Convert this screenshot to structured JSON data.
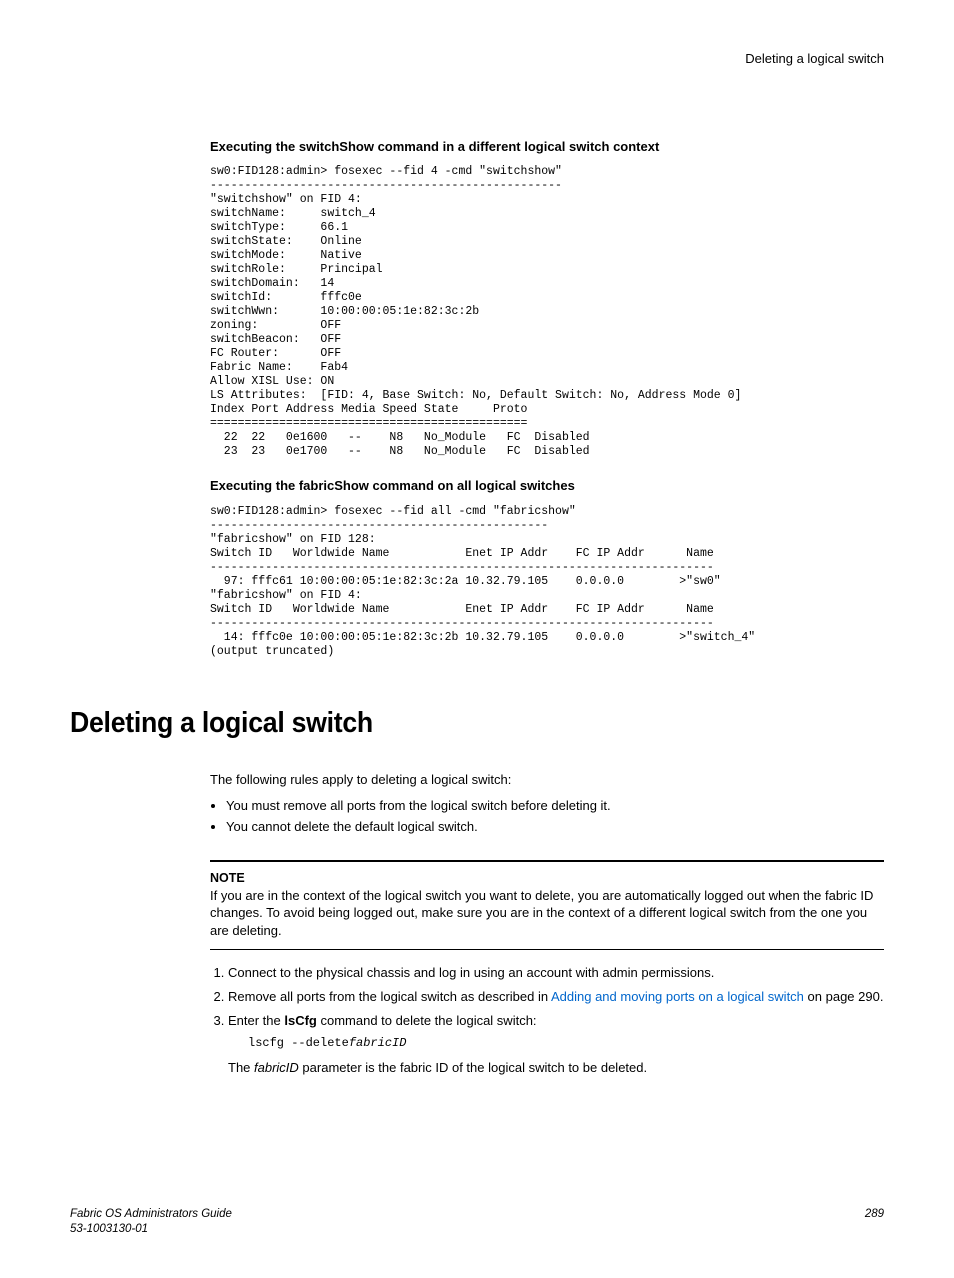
{
  "header": {
    "running_head": "Deleting a logical switch"
  },
  "block1": {
    "heading": "Executing the switchShow command in a different logical switch context",
    "code": "sw0:FID128:admin> fosexec --fid 4 -cmd \"switchshow\"\n---------------------------------------------------\n\"switchshow\" on FID 4:\nswitchName:     switch_4\nswitchType:     66.1\nswitchState:    Online\nswitchMode:     Native\nswitchRole:     Principal\nswitchDomain:   14\nswitchId:       fffc0e\nswitchWwn:      10:00:00:05:1e:82:3c:2b\nzoning:         OFF\nswitchBeacon:   OFF\nFC Router:      OFF\nFabric Name:    Fab4\nAllow XISL Use: ON\nLS Attributes:  [FID: 4, Base Switch: No, Default Switch: No, Address Mode 0]\nIndex Port Address Media Speed State     Proto\n==============================================\n  22  22   0e1600   --    N8   No_Module   FC  Disabled\n  23  23   0e1700   --    N8   No_Module   FC  Disabled"
  },
  "block2": {
    "heading": "Executing the fabricShow command on all logical switches",
    "code": "sw0:FID128:admin> fosexec --fid all -cmd \"fabricshow\"\n-------------------------------------------------\n\"fabricshow\" on FID 128:\nSwitch ID   Worldwide Name           Enet IP Addr    FC IP Addr      Name\n-------------------------------------------------------------------------\n  97: fffc61 10:00:00:05:1e:82:3c:2a 10.32.79.105    0.0.0.0        >\"sw0\"\n\"fabricshow\" on FID 4:\nSwitch ID   Worldwide Name           Enet IP Addr    FC IP Addr      Name\n-------------------------------------------------------------------------\n  14: fffc0e 10:00:00:05:1e:82:3c:2b 10.32.79.105    0.0.0.0        >\"switch_4\"\n(output truncated)"
  },
  "section": {
    "title": "Deleting a logical switch",
    "intro": "The following rules apply to deleting a logical switch:",
    "bullets": [
      "You must remove all ports from the logical switch before deleting it.",
      "You cannot delete the default logical switch."
    ],
    "note_label": "NOTE",
    "note_body": "If you are in the context of the logical switch you want to delete, you are automatically logged out when the fabric ID changes. To avoid being logged out, make sure you are in the context of a different logical switch from the one you are deleting.",
    "steps": {
      "s1": "Connect to the physical chassis and log in using an account with admin permissions.",
      "s2_a": "Remove all ports from the logical switch as described in ",
      "s2_link": "Adding and moving ports on a logical switch",
      "s2_b": " on page 290.",
      "s3_a": "Enter the ",
      "s3_bold": "lsCfg",
      "s3_b": " command to delete the logical switch:"
    },
    "cmd_prefix": "lscfg --delete",
    "cmd_arg": "fabricID",
    "param_a": "The ",
    "param_i": "fabricID",
    "param_b": " parameter is the fabric ID of the logical switch to be deleted."
  },
  "footer": {
    "guide": "Fabric OS Administrators Guide",
    "docnum": "53-1003130-01",
    "page": "289"
  }
}
